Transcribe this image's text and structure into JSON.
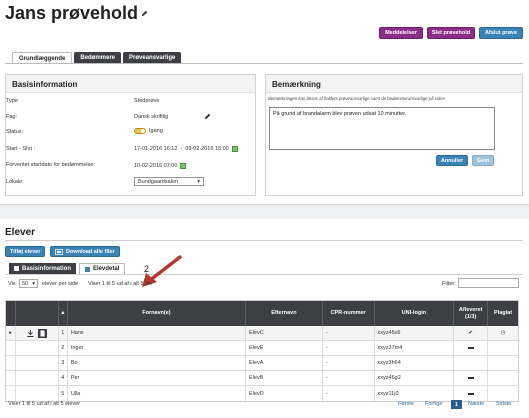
{
  "header": {
    "title": "Jans prøvehold",
    "buttons": {
      "messages": "Meddelelser",
      "delete": "Slet prøvehold",
      "finish": "Afslut prøve"
    }
  },
  "tabs": [
    "Grundlæggende",
    "Bedømmere",
    "Prøveansvarlige"
  ],
  "basis": {
    "title": "Basisinformation",
    "fields": {
      "type": {
        "label": "Type",
        "value": "Stedprøve"
      },
      "subject": {
        "label": "Fag:",
        "value": "Dansk skriftlig"
      },
      "status": {
        "label": "Status:",
        "value": "Igang"
      },
      "period": {
        "label": "Start - Slut :",
        "start": "17-01-2016 16:12",
        "separator": "-",
        "end": "09-02-2016 15:00"
      },
      "grading": {
        "label": "Forventet startdato for bedømmelse:",
        "value": "10-02-2016 07:00"
      },
      "venue": {
        "label": "Lokale:",
        "value": "Bundgaardsalen"
      }
    }
  },
  "remark": {
    "title": "Bemærkning",
    "hint": "Bemærkningen kan læses af holdets prøveansvarlige samt de bedømmeransvarlige på siden",
    "text": "På grund af brandalarm blev prøven udsat 10 minutter.",
    "cancel": "Annuller",
    "save": "Gem"
  },
  "elever": {
    "title": "Elever",
    "add_button": "Tilføj elever",
    "download_button": "Download alle filer",
    "tabs": [
      "Basisinformation",
      "Elevdetal"
    ],
    "annotation": "2",
    "show_label": "Vis",
    "page_size": "50",
    "per_page": "elever per side",
    "showing": "Viser 1 til 5 ud af i alt 5 ele",
    "filter_label": "Filter:",
    "columns": [
      "Fornavn(e)",
      "Efternavn",
      "CPR-nummer",
      "UNI-login",
      "Afleveret (1/3)",
      "Plagiat"
    ],
    "rows": [
      {
        "num": "1",
        "first": "Hans",
        "last": "ElevC",
        "cpr": "-",
        "uni": "xxyz45x6",
        "delivered": "check",
        "plagiat": "clock"
      },
      {
        "num": "2",
        "first": "Inger",
        "last": "ElevE",
        "cpr": "-",
        "uni": "xxyz37m4",
        "delivered": "dash",
        "plagiat": ""
      },
      {
        "num": "3",
        "first": "Bo",
        "last": "ElevA",
        "cpr": "-",
        "uni": "xxyz3h64",
        "delivered": "",
        "plagiat": ""
      },
      {
        "num": "4",
        "first": "Per",
        "last": "ElevB",
        "cpr": "-",
        "uni": "xxyz46g2",
        "delivered": "dash",
        "plagiat": ""
      },
      {
        "num": "5",
        "first": "Ulla",
        "last": "ElevD",
        "cpr": "-",
        "uni": "xxyz11j0",
        "delivered": "dash",
        "plagiat": ""
      }
    ],
    "footer": "Viser 1 til 5 ud af i alt 5 elever",
    "pager": {
      "first": "Første",
      "prev": "Forrige",
      "page": "1",
      "next": "Næste",
      "last": "Sidste"
    }
  },
  "colors": {
    "purple": "#8e2c8a",
    "blue": "#3a83b7",
    "dark": "#3d3f44",
    "annotation_arrow": "#b0392b"
  }
}
